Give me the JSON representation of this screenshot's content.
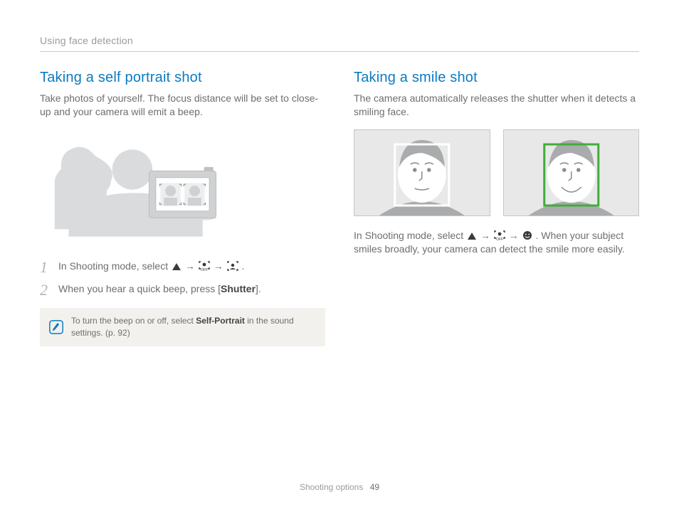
{
  "header": {
    "section": "Using face detection"
  },
  "left": {
    "title": "Taking a self portrait shot",
    "lead": "Take photos of yourself. The focus distance will be set to close-up and your camera will emit a beep.",
    "steps": [
      {
        "num": "1",
        "pre": "In Shooting mode, select ",
        "post": "."
      },
      {
        "num": "2",
        "pre": "When you hear a quick beep, press [",
        "bold": "Shutter",
        "post": "]."
      }
    ],
    "tip": {
      "pre": "To turn the beep on or off, select ",
      "bold": "Self-Portrait",
      "post": " in the sound settings. (p. 92)"
    }
  },
  "right": {
    "title": "Taking a smile shot",
    "lead": "The camera automatically releases the shutter when it detects a smiling face.",
    "instr": {
      "pre": "In Shooting mode, select ",
      "post": ". When your subject smiles broadly, your camera can detect the smile more easily."
    }
  },
  "footer": {
    "label": "Shooting options",
    "page": "49"
  }
}
